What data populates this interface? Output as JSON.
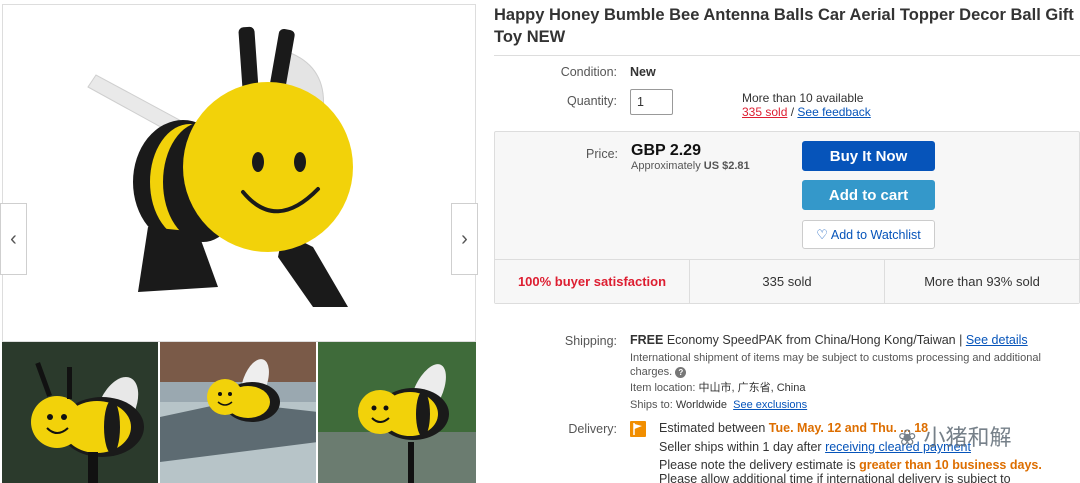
{
  "title": "Happy Honey Bumble Bee Antenna Balls Car Aerial Topper Decor Ball Gift Toy NEW",
  "gallery": {
    "prev_icon": "chevron-left-icon",
    "next_icon": "chevron-right-icon",
    "prev_glyph": "‹",
    "next_glyph": "›"
  },
  "condition": {
    "label": "Condition:",
    "value": "New"
  },
  "quantity": {
    "label": "Quantity:",
    "value": "1",
    "available": "More than 10 available",
    "sold_link": "335 sold",
    "separator": " / ",
    "feedback_link": "See feedback"
  },
  "price": {
    "label": "Price:",
    "value": "GBP 2.29",
    "approx_prefix": "Approximately",
    "approx_value": "US $2.81"
  },
  "buttons": {
    "buy_now": "Buy It Now",
    "add_to_cart": "Add to cart",
    "watchlist": "Add to Watchlist",
    "watchlist_icon": "heart-icon"
  },
  "stats": {
    "satisfaction": "100% buyer satisfaction",
    "sold": "335 sold",
    "more_than": "More than 93% sold"
  },
  "shipping": {
    "label": "Shipping:",
    "free": "FREE",
    "method": " Economy SpeedPAK from China/Hong Kong/Taiwan | ",
    "details_link": "See details",
    "note_line1": "International shipment of items may be subject to customs processing and additional",
    "note_line2": "charges.",
    "item_location_label": "Item location:",
    "item_location": "中山市, 广东省, China",
    "ships_to_label": "Ships to:",
    "ships_to": "Worldwide",
    "exclusions_link": "See exclusions"
  },
  "delivery": {
    "label": "Delivery:",
    "estimated_prefix": "Estimated between ",
    "estimated_dates": "Tue. May. 12 and Thu. ... 18",
    "seller_prefix": "Seller ships within 1 day after ",
    "seller_link": "receiving cleared payment",
    "note_prefix": "Please note the delivery estimate is ",
    "note_highlight": "greater than 10 business days.",
    "note_line2": "Please allow additional time if international delivery is subject to"
  },
  "watermark": "小猪和解",
  "colors": {
    "buy_blue": "#0654ba",
    "cart_blue": "#3498ca",
    "red": "#dd1e31",
    "orange": "#dd6e00",
    "bee_yellow": "#f2d20a"
  }
}
